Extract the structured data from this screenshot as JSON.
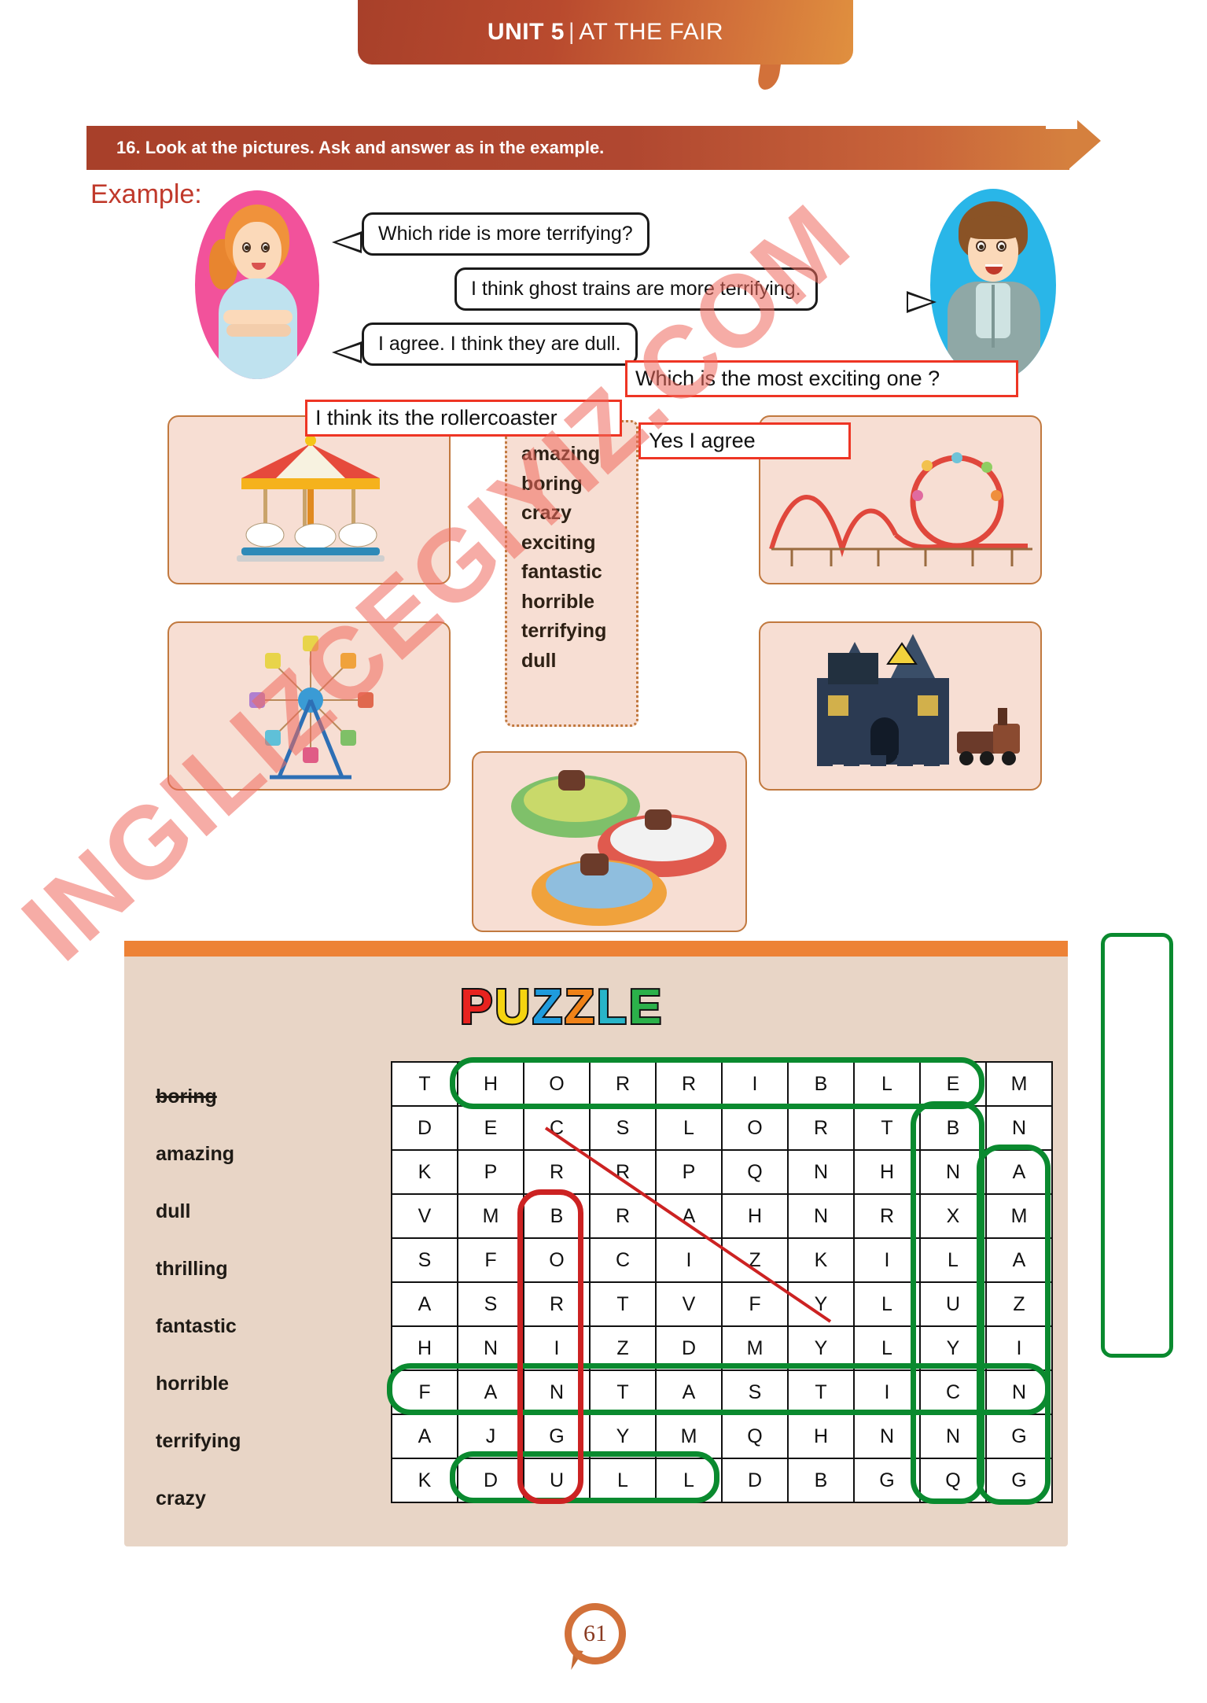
{
  "header": {
    "unit": "UNIT 5",
    "separator": "|",
    "title": "AT THE FAIR"
  },
  "instruction": {
    "text": "16. Look at the pictures. Ask and answer as in the example."
  },
  "example": {
    "label": "Example:",
    "bubbles": [
      {
        "id": "q1",
        "text": "Which ride is more terrifying?",
        "speaker": "girl"
      },
      {
        "id": "a1",
        "text": "I think ghost trains are more terrifying.",
        "speaker": "boy"
      },
      {
        "id": "q2",
        "text": "I agree. I think they are dull.",
        "speaker": "girl"
      }
    ],
    "answers": [
      {
        "id": "ans1",
        "text": "Which is the most exciting one ?"
      },
      {
        "id": "ans2",
        "text": "I think its the rollercoaster"
      },
      {
        "id": "ans3",
        "text": "Yes I agree"
      }
    ]
  },
  "adjective_box": {
    "words": [
      "amazing",
      "boring",
      "crazy",
      "exciting",
      "fantastic",
      "horrible",
      "terrifying",
      "dull"
    ]
  },
  "pictures": [
    {
      "name": "carousel",
      "label": "carousel"
    },
    {
      "name": "rollercoaster",
      "label": "rollercoaster"
    },
    {
      "name": "ferris-wheel",
      "label": "ferris wheel"
    },
    {
      "name": "ghost-train",
      "label": "ghost train"
    },
    {
      "name": "bumper-cars",
      "label": "bumper cars"
    }
  ],
  "puzzle": {
    "title": "PUZZLE",
    "title_letters": [
      {
        "ch": "P",
        "color": "#e8231f"
      },
      {
        "ch": "U",
        "color": "#f5d410"
      },
      {
        "ch": "Z",
        "color": "#1f9bdd"
      },
      {
        "ch": "Z",
        "color": "#f08218"
      },
      {
        "ch": "L",
        "color": "#28b5c9"
      },
      {
        "ch": "E",
        "color": "#2bb14a"
      }
    ],
    "words": [
      {
        "text": "boring",
        "found": true
      },
      {
        "text": "amazing",
        "found": false
      },
      {
        "text": "dull",
        "found": false
      },
      {
        "text": "thrilling",
        "found": false
      },
      {
        "text": "fantastic",
        "found": false
      },
      {
        "text": "horrible",
        "found": false
      },
      {
        "text": "terrifying",
        "found": false
      },
      {
        "text": "crazy",
        "found": false
      }
    ],
    "grid": [
      [
        "T",
        "H",
        "O",
        "R",
        "R",
        "I",
        "B",
        "L",
        "E",
        "M"
      ],
      [
        "D",
        "E",
        "C",
        "S",
        "L",
        "O",
        "R",
        "T",
        "B",
        "N"
      ],
      [
        "K",
        "P",
        "R",
        "R",
        "P",
        "Q",
        "N",
        "H",
        "N",
        "A"
      ],
      [
        "V",
        "M",
        "B",
        "R",
        "A",
        "H",
        "N",
        "R",
        "X",
        "M"
      ],
      [
        "S",
        "F",
        "O",
        "C",
        "I",
        "Z",
        "K",
        "I",
        "L",
        "A"
      ],
      [
        "A",
        "S",
        "R",
        "T",
        "V",
        "F",
        "Y",
        "L",
        "U",
        "Z"
      ],
      [
        "H",
        "N",
        "I",
        "Z",
        "D",
        "M",
        "Y",
        "L",
        "Y",
        "I"
      ],
      [
        "F",
        "A",
        "N",
        "T",
        "A",
        "S",
        "T",
        "I",
        "C",
        "N"
      ],
      [
        "A",
        "J",
        "G",
        "Y",
        "M",
        "Q",
        "H",
        "N",
        "N",
        "G"
      ],
      [
        "K",
        "D",
        "U",
        "L",
        "L",
        "D",
        "B",
        "G",
        "Q",
        "G"
      ]
    ],
    "found_words": [
      {
        "word": "HORRIBLE",
        "orientation": "horizontal",
        "color": "#0a8a2f"
      },
      {
        "word": "THRILLING",
        "orientation": "vertical",
        "color": "#0a8a2f"
      },
      {
        "word": "AMAZING",
        "orientation": "vertical",
        "color": "#0a8a2f"
      },
      {
        "word": "FANTASTIC",
        "orientation": "horizontal",
        "color": "#0a8a2f"
      },
      {
        "word": "DULL",
        "orientation": "horizontal",
        "color": "#0a8a2f"
      },
      {
        "word": "BORING",
        "orientation": "vertical",
        "color": "#cc2222"
      },
      {
        "word": "CRAZY",
        "orientation": "diagonal",
        "color": "#cc2222"
      }
    ]
  },
  "page": {
    "number": "61"
  },
  "watermark": {
    "text": "INGILIZCEGIYIZ.COM"
  },
  "colors": {
    "banner_dark": "#a8402a",
    "banner_light": "#e0903f",
    "accent_orange": "#ed8236",
    "panel_bg": "#e8d5c6",
    "card_bg": "#f7ded3",
    "highlight_green": "#0a8a2f",
    "highlight_red": "#cc2222",
    "example_red": "#c0392b"
  }
}
